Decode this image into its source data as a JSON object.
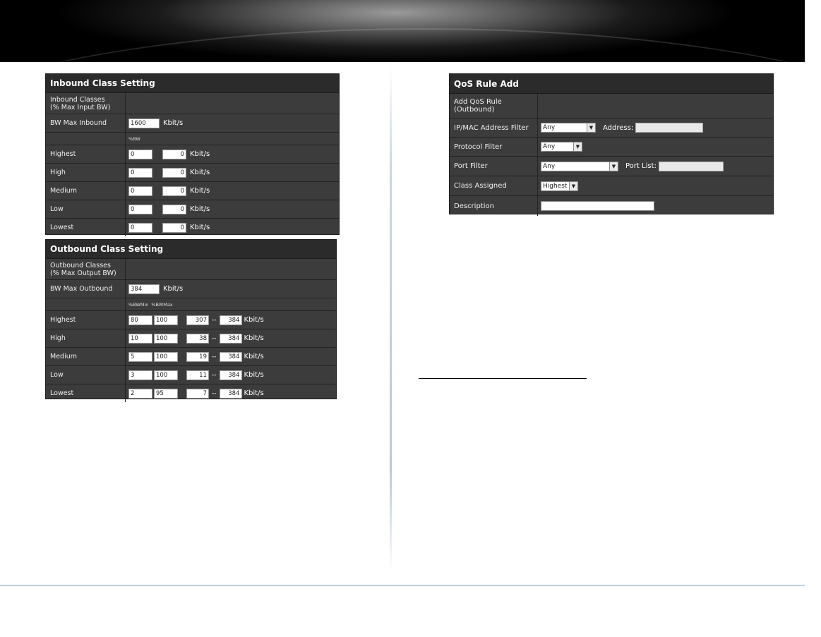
{
  "inbound": {
    "title": "Inbound Class Setting",
    "classes_label": "Inbound Classes\n(% Max Input BW)",
    "bw_max_label": "BW Max Inbound",
    "bw_max_value": "1600",
    "unit": "Kbit/s",
    "col_header": "%BW",
    "rows": [
      {
        "label": "Highest",
        "percent": "0",
        "kbit": "0"
      },
      {
        "label": "High",
        "percent": "0",
        "kbit": "0"
      },
      {
        "label": "Medium",
        "percent": "0",
        "kbit": "0"
      },
      {
        "label": "Low",
        "percent": "0",
        "kbit": "0"
      },
      {
        "label": "Lowest",
        "percent": "0",
        "kbit": "0"
      }
    ]
  },
  "outbound": {
    "title": "Outbound Class Setting",
    "classes_label": "Outbound Classes\n(% Max Output BW)",
    "bw_max_label": "BW Max Outbound",
    "bw_max_value": "384",
    "unit": "Kbit/s",
    "col_header_min": "%BWMin",
    "col_header_max": "%BWMax",
    "separator": "--",
    "rows": [
      {
        "label": "Highest",
        "min": "80",
        "max": "100",
        "kmin": "307",
        "kmax": "384"
      },
      {
        "label": "High",
        "min": "10",
        "max": "100",
        "kmin": "38",
        "kmax": "384"
      },
      {
        "label": "Medium",
        "min": "5",
        "max": "100",
        "kmin": "19",
        "kmax": "384"
      },
      {
        "label": "Low",
        "min": "3",
        "max": "100",
        "kmin": "11",
        "kmax": "384"
      },
      {
        "label": "Lowest",
        "min": "2",
        "max": "95",
        "kmin": "7",
        "kmax": "384"
      }
    ]
  },
  "qos": {
    "title": "QoS Rule Add",
    "add_label": "Add QoS Rule\n(Outbound)",
    "ipmac_label": "IP/MAC Address Filter",
    "ipmac_value": "Any",
    "address_label": "Address:",
    "protocol_label": "Protocol Filter",
    "protocol_value": "Any",
    "port_label": "Port Filter",
    "port_value": "Any",
    "portlist_label": "Port List:",
    "class_label": "Class Assigned",
    "class_value": "Highest",
    "description_label": "Description"
  }
}
